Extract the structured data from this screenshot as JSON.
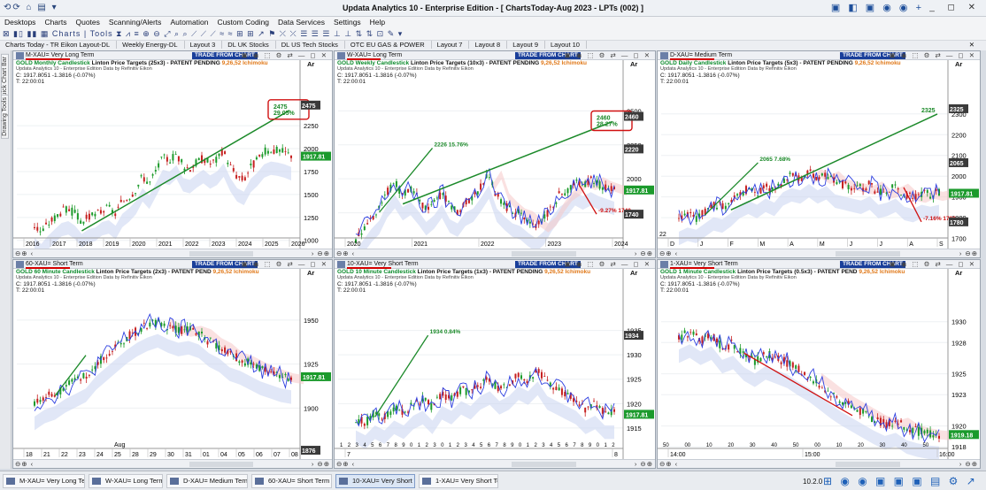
{
  "app": {
    "title": "Updata Analytics 10 - Enterprise Edition - [ ChartsToday-Aug 2023 - LPTs (002) ]"
  },
  "menu": [
    "Desktops",
    "Charts",
    "Quotes",
    "Scanning/Alerts",
    "Automation",
    "Custom Coding",
    "Data Services",
    "Settings",
    "Help"
  ],
  "toolbar": {
    "charts_label": "Charts",
    "tools_label": "Tools"
  },
  "layout_tabs": [
    "Charts Today - TR Eikon Layout-DL",
    "Weekly Energy-DL",
    "Layout 3",
    "DL UK Stocks",
    "DL US Tech Stocks",
    "OTC EU GAS & POWER",
    "Layout 7",
    "Layout 8",
    "Layout 9",
    "Layout 10"
  ],
  "sidebar": [
    "Quick Chart Bar",
    "Drawing Tools"
  ],
  "common": {
    "trade_button": "TRADE FROM CHART",
    "close_line": "C: 1917.8051  -1.3816 (-0.07%)",
    "time_line": "T: 22:00:01",
    "edition_line": "Updata Analytics 10 - Enterprise Edition   Data by Refinitiv Eikon",
    "axis_header": "Ar",
    "ichimoku": "9,26,52 Ichimoku"
  },
  "panels": [
    {
      "name": "M-XAU= Very Long Term",
      "ctype": "GOLD Monthly Candlestick",
      "lpt": "Linton Price Targets (25x3) - PATENT PENDING",
      "chart_data": {
        "type": "line",
        "title": "GOLD Monthly Candlestick",
        "x_ticks": [
          "2016",
          "2017",
          "2018",
          "2019",
          "2020",
          "2021",
          "2022",
          "2023",
          "2024",
          "2025",
          "2026"
        ],
        "y_ticks": [
          1000,
          1250,
          1500,
          1750,
          2000,
          2250
        ],
        "ylim": [
          930,
          2560
        ],
        "current_price": "1917.81",
        "target_top": "2475",
        "target_pct": "29.05%",
        "axis_tags": [
          "2475"
        ],
        "close_profile": [
          1160,
          1090,
          1180,
          1250,
          1320,
          1340,
          1290,
          1200,
          1250,
          1270,
          1330,
          1350,
          1290,
          1420,
          1480,
          1560,
          1700,
          1620,
          1760,
          1900,
          1880,
          1950,
          1810,
          1790,
          1850,
          1900,
          1840,
          1880,
          1970,
          1810,
          1700,
          1660,
          1800,
          1870,
          1960,
          1990,
          1980,
          1960,
          1930
        ]
      }
    },
    {
      "name": "W-XAU= Long Term",
      "ctype": "GOLD Weekly Candlestick",
      "lpt": "Linton Price Targets (10x3) - PATENT PENDING",
      "chart_data": {
        "type": "line",
        "title": "GOLD Weekly Candlestick",
        "x_ticks": [
          "2020",
          "2021",
          "2022",
          "2023",
          "2024"
        ],
        "y_ticks": [
          1750,
          2000,
          2250,
          2500
        ],
        "ylim": [
          1500,
          2600
        ],
        "current_price": "1917.81",
        "target_top": "2460",
        "target_pct": "28.27%",
        "targets": [
          "2226 15.76%",
          "-9.27% 1740"
        ],
        "axis_tags": [
          "2460",
          "2220",
          "1740"
        ],
        "close_profile": [
          1560,
          1640,
          1720,
          1780,
          1900,
          1970,
          1880,
          1920,
          1850,
          1770,
          1820,
          1900,
          1790,
          1760,
          1840,
          1870,
          1950,
          2040,
          1870,
          1810,
          1760,
          1740,
          1690,
          1650,
          1700,
          1800,
          1880,
          1920,
          1990,
          1960,
          1990,
          1960,
          1940,
          1920
        ]
      }
    },
    {
      "name": "D-XAU= Medium Term",
      "ctype": "GOLD Daily Candlestick",
      "lpt": "Linton Price Targets (5x3) - PATENT PENDING",
      "chart_data": {
        "type": "line",
        "title": "GOLD Daily Candlestick",
        "x_ticks": [
          "D",
          "J",
          "F",
          "M",
          "A",
          "M",
          "J",
          "J",
          "A",
          "S"
        ],
        "x_year": "22",
        "y_ticks": [
          1700,
          1800,
          1900,
          2000,
          2100,
          2200,
          2300
        ],
        "ylim": [
          1660,
          2380
        ],
        "current_price": "1917.81",
        "target_top": "2325",
        "targets": [
          "2065 7.68%",
          "-7.16% 1780"
        ],
        "axis_tags": [
          "2325",
          "2065",
          "1780"
        ],
        "close_profile": [
          1790,
          1810,
          1800,
          1830,
          1860,
          1850,
          1880,
          1920,
          1940,
          1920,
          1950,
          1930,
          1980,
          2000,
          1990,
          2020,
          1990,
          2010,
          1970,
          1960,
          1950,
          1940,
          1960,
          1920,
          1930,
          1950,
          1910,
          1900,
          1920,
          1910,
          1920
        ]
      }
    },
    {
      "name": "60-XAU= Short Term",
      "ctype": "GOLD 60 Minute Candlestick",
      "lpt": "Linton Price Targets (2x3) - PATENT PEND",
      "chart_data": {
        "type": "line",
        "title": "GOLD 60 Minute Candlestick",
        "x_ticks": [
          "18",
          "21",
          "22",
          "23",
          "24",
          "25",
          "28",
          "29",
          "30",
          "31",
          "01",
          "04",
          "05",
          "06",
          "07",
          "08"
        ],
        "x_month": "Aug",
        "y_ticks": [
          1900,
          1925,
          1950
        ],
        "ylim": [
          1872,
          1958
        ],
        "current_price": "1917.81",
        "axis_tags": [
          "1876"
        ],
        "close_profile": [
          1902,
          1906,
          1908,
          1912,
          1915,
          1918,
          1925,
          1930,
          1935,
          1940,
          1944,
          1947,
          1949,
          1946,
          1944,
          1945,
          1943,
          1938,
          1935,
          1930,
          1928,
          1925,
          1922,
          1920,
          1918,
          1917
        ]
      }
    },
    {
      "name": "10-XAU= Very Short Term",
      "ctype": "GOLD 10 Minute Candlestick",
      "lpt": "Linton Price Targets (1x3) - PATENT PENDING",
      "chart_data": {
        "type": "line",
        "title": "GOLD 10 Minute Candlestick",
        "x_ticks": [
          "7",
          "8"
        ],
        "x_minor": [
          "1",
          "2",
          "3",
          "4",
          "5",
          "6",
          "7",
          "8",
          "9",
          "0",
          "1",
          "2",
          "3",
          "0",
          "1",
          "2",
          "3",
          "4",
          "5",
          "6",
          "7",
          "8",
          "9",
          "0",
          "1",
          "2",
          "3",
          "4",
          "5",
          "6",
          "7",
          "8",
          "9",
          "0",
          "1",
          "2"
        ],
        "y_ticks": [
          1915,
          1920,
          1925,
          1930,
          1935
        ],
        "ylim": [
          1909,
          1940
        ],
        "current_price": "1917.81",
        "targets": [
          "1934 0.84%"
        ],
        "axis_tags": [
          "1934"
        ],
        "close_profile": [
          1917,
          1916,
          1918,
          1917,
          1919,
          1918,
          1920,
          1921,
          1919,
          1922,
          1921,
          1923,
          1922,
          1924,
          1925,
          1923,
          1924,
          1926,
          1925,
          1927,
          1924,
          1923,
          1922,
          1921,
          1919,
          1920,
          1918,
          1918
        ]
      }
    },
    {
      "name": "1-XAU= Very Short Term",
      "ctype": "GOLD 1 Minute Candlestick",
      "lpt": "Linton Price Targets (0.5x3) - PATENT PEND",
      "chart_data": {
        "type": "line",
        "title": "GOLD 1 Minute Candlestick",
        "x_ticks": [
          "14:00",
          "15:00",
          "16:00"
        ],
        "x_minor": [
          "50",
          "00",
          "10",
          "20",
          "30",
          "40",
          "50",
          "00",
          "10",
          "20",
          "30",
          "40",
          "50"
        ],
        "y_ticks": [
          1918,
          1920,
          1923,
          1925,
          1928,
          1930
        ],
        "ylim": [
          1917,
          1931.5
        ],
        "current_price": "1919.18",
        "close_profile": [
          1928.5,
          1929,
          1928.3,
          1928.8,
          1927.5,
          1927.9,
          1926.8,
          1926.2,
          1926.9,
          1926.5,
          1926.1,
          1925.4,
          1924.8,
          1924.0,
          1923.2,
          1922.5,
          1921.9,
          1921.3,
          1920.7,
          1920.2,
          1920.5,
          1919.8,
          1919.5,
          1919.3,
          1919.2
        ]
      }
    }
  ],
  "taskbar": [
    "M-XAU= Very Long Term",
    "W-XAU= Long Term",
    "D-XAU= Medium Term",
    "60-XAU= Short Term",
    "10-XAU= Very Short Term",
    "1-XAU= Very Short Term"
  ],
  "version": "10.2.0"
}
